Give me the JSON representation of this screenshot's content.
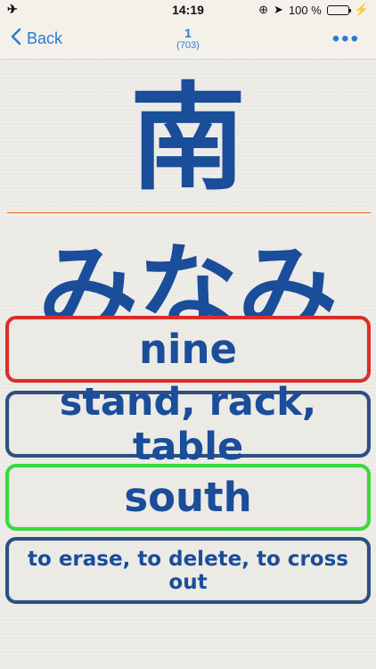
{
  "status_bar": {
    "time": "14:19",
    "battery_percent": "100 %",
    "battery_level": 1.0
  },
  "nav": {
    "back_label": "Back",
    "card_number": "1",
    "total_cards": "(703)"
  },
  "card": {
    "kanji": "南",
    "reading": "みなみ"
  },
  "answers": [
    {
      "label": "nine",
      "state": "incorrect",
      "border_color": "#d92e2a"
    },
    {
      "label": "stand, rack, table",
      "state": "neutral",
      "border_color": "#2c4f84"
    },
    {
      "label": "south",
      "state": "correct",
      "border_color": "#39d93a"
    },
    {
      "label": "to erase, to delete, to cross out",
      "state": "neutral",
      "border_color": "#2c4f84"
    }
  ]
}
